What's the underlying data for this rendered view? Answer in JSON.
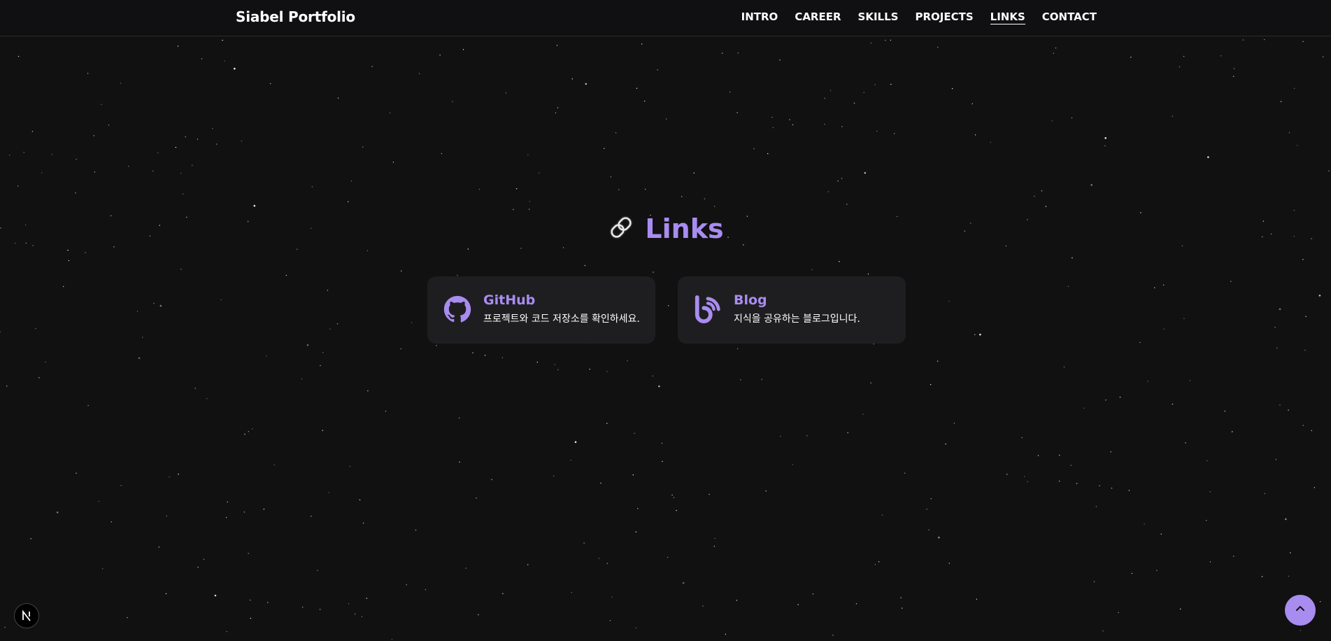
{
  "brand": "Siabel Portfolio",
  "nav": [
    {
      "label": "INTRO",
      "active": false
    },
    {
      "label": "CAREER",
      "active": false
    },
    {
      "label": "SKILLS",
      "active": false
    },
    {
      "label": "PROJECTS",
      "active": false
    },
    {
      "label": "LINKS",
      "active": true
    },
    {
      "label": "CONTACT",
      "active": false
    }
  ],
  "section": {
    "title": "Links",
    "icon": "link-icon"
  },
  "cards": [
    {
      "title": "GitHub",
      "description": "프로젝트와 코드 저장소를 확인하세요.",
      "icon": "github-icon"
    },
    {
      "title": "Blog",
      "description": "지식을 공유하는 블로그입니다.",
      "icon": "blog-icon"
    }
  ],
  "colors": {
    "background": "#111112",
    "accent": "#a98cf0",
    "card": "#1e1e20"
  },
  "widgets": {
    "next_badge_icon": "next-logo-icon",
    "scroll_top_icon": "arrow-up-icon"
  }
}
